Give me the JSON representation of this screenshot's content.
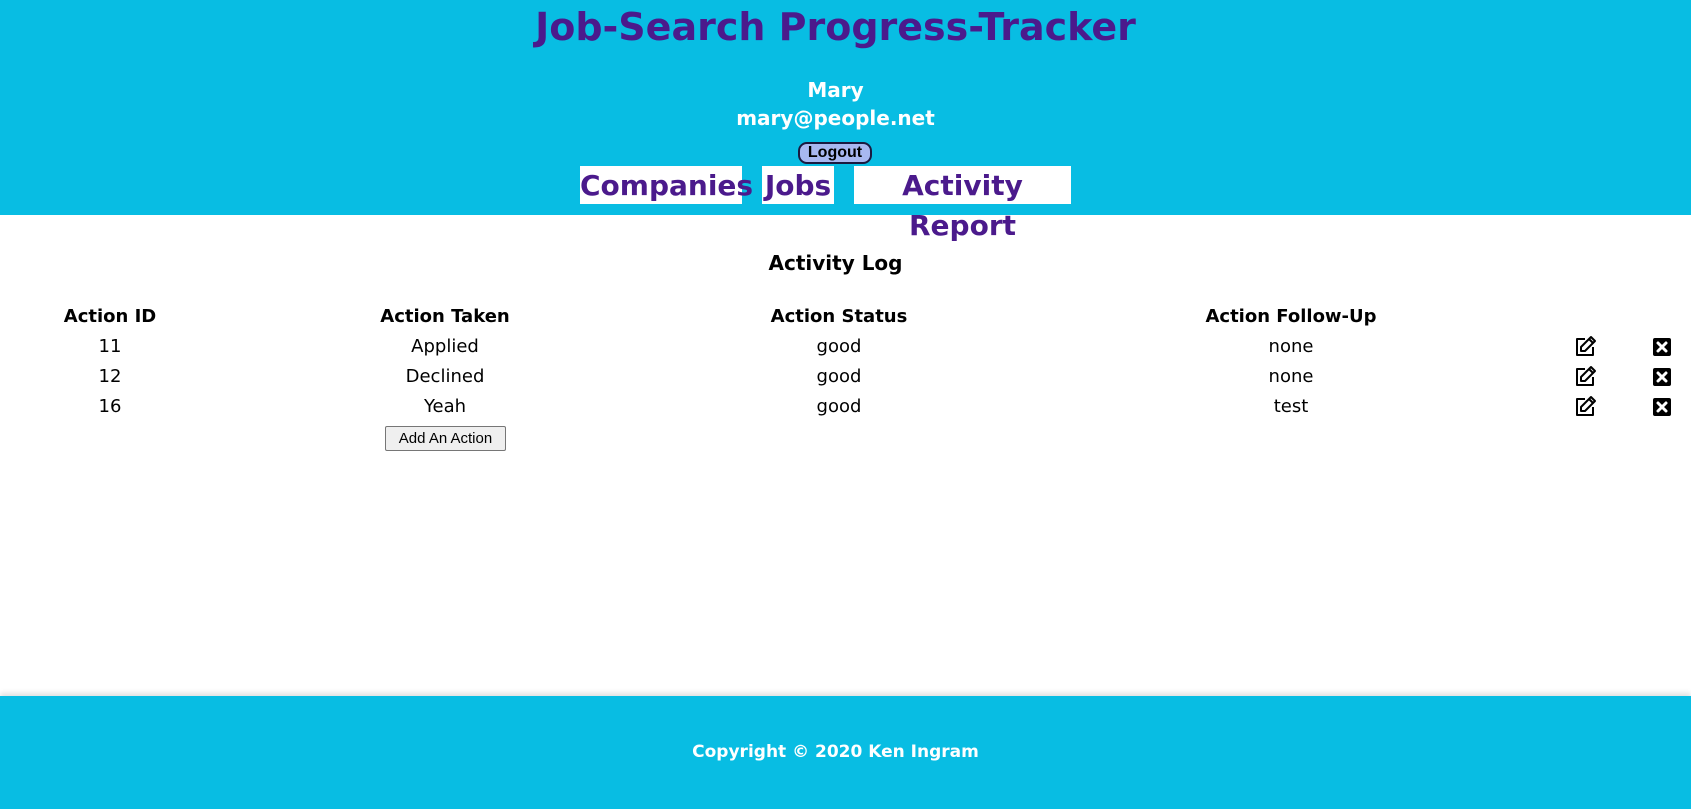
{
  "header": {
    "title": "Job-Search Progress-Tracker",
    "user_name": "Mary",
    "user_email": "mary@people.net",
    "logout_label": "Logout",
    "nav": {
      "companies": "Companies",
      "jobs": "Jobs",
      "activity_report": "Activity Report"
    }
  },
  "main": {
    "heading": "Activity Log",
    "columns": {
      "id": "Action ID",
      "taken": "Action Taken",
      "status": "Action Status",
      "follow_up": "Action Follow-Up"
    },
    "rows": [
      {
        "id": "11",
        "taken": "Applied",
        "status": "good",
        "follow_up": "none"
      },
      {
        "id": "12",
        "taken": "Declined",
        "status": "good",
        "follow_up": "none"
      },
      {
        "id": "16",
        "taken": "Yeah",
        "status": "good",
        "follow_up": "test"
      }
    ],
    "row_icons": {
      "edit": "edit-icon",
      "delete": "delete-icon"
    },
    "add_button_label": "Add An Action"
  },
  "footer": {
    "copyright": "Copyright © 2020 Ken Ingram"
  },
  "colors": {
    "header_bg": "#08bde3",
    "title": "#4b1a8c",
    "logout_bg": "#a8b8f0"
  }
}
